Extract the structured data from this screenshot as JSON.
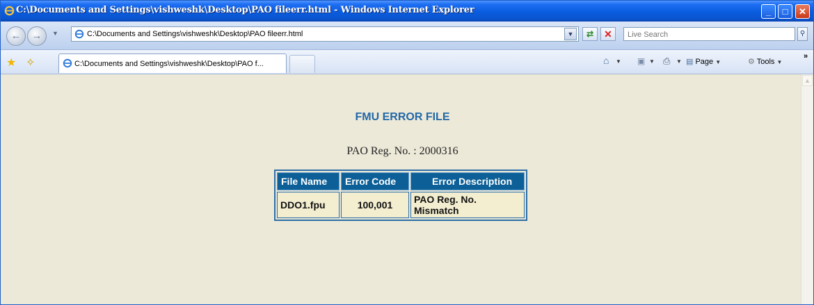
{
  "window": {
    "title": "C:\\Documents and Settings\\vishweshk\\Desktop\\PAO fileerr.html - Windows Internet Explorer",
    "minimize": "_",
    "maximize": "□",
    "close": "✕"
  },
  "address_bar": {
    "url": "C:\\Documents and Settings\\vishweshk\\Desktop\\PAO fileerr.html",
    "search_placeholder": "Live Search"
  },
  "tabs": [
    {
      "label": "C:\\Documents and Settings\\vishweshk\\Desktop\\PAO f..."
    }
  ],
  "command_bar": {
    "page_label": "Page",
    "tools_label": "Tools"
  },
  "page": {
    "heading": "FMU ERROR FILE",
    "reg_no_line": "PAO Reg. No. : 2000316",
    "table": {
      "headers": [
        "File Name",
        "Error Code",
        "Error Description"
      ],
      "rows": [
        [
          "DDO1.fpu",
          "100,001",
          "PAO Reg. No. Mismatch"
        ]
      ]
    }
  },
  "colors": {
    "titlebar": "#0a5cdf",
    "heading": "#2268a8",
    "table_header_bg": "#0c5f97",
    "table_cell_bg": "#f3eed0",
    "page_bg": "#ece9d8"
  }
}
